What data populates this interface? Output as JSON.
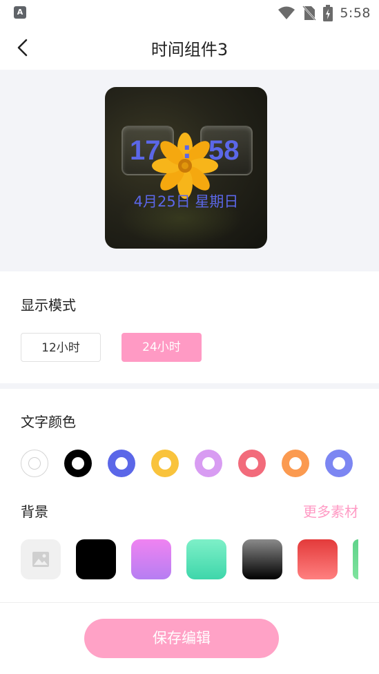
{
  "status_bar": {
    "app_icon": "A",
    "time": "5:58",
    "icons": [
      "wifi-icon",
      "no-sim-icon",
      "battery-charging-icon"
    ]
  },
  "header": {
    "title": "时间组件3",
    "back_icon": "chevron-left-icon"
  },
  "preview": {
    "hour": "17",
    "colon": ":",
    "minute": "58",
    "date": "4月25日  星期日",
    "digit_color": "#5b67e8"
  },
  "display_mode": {
    "title": "显示模式",
    "options": [
      "12小时",
      "24小时"
    ],
    "selected": "24小时"
  },
  "text_color": {
    "title": "文字颜色",
    "swatches": [
      {
        "name": "none",
        "color": "#ffffff"
      },
      {
        "name": "black",
        "color": "#000000"
      },
      {
        "name": "blue",
        "color": "#5b67e8"
      },
      {
        "name": "yellow",
        "color": "#f9c33c"
      },
      {
        "name": "violet",
        "color": "#d89cf2"
      },
      {
        "name": "red",
        "color": "#f26b7b"
      },
      {
        "name": "orange",
        "color": "#fb9a50"
      },
      {
        "name": "indigo",
        "color": "#7c86f2"
      }
    ]
  },
  "background": {
    "title": "背景",
    "more_label": "更多素材",
    "tiles": [
      "image-placeholder",
      "black",
      "purple-gradient",
      "mint-gradient",
      "gray-gradient",
      "red-gradient",
      "green-gradient"
    ]
  },
  "footer": {
    "save_label": "保存编辑"
  },
  "colors": {
    "accent": "#ff9ac4",
    "save_button": "#ffa2c6"
  }
}
